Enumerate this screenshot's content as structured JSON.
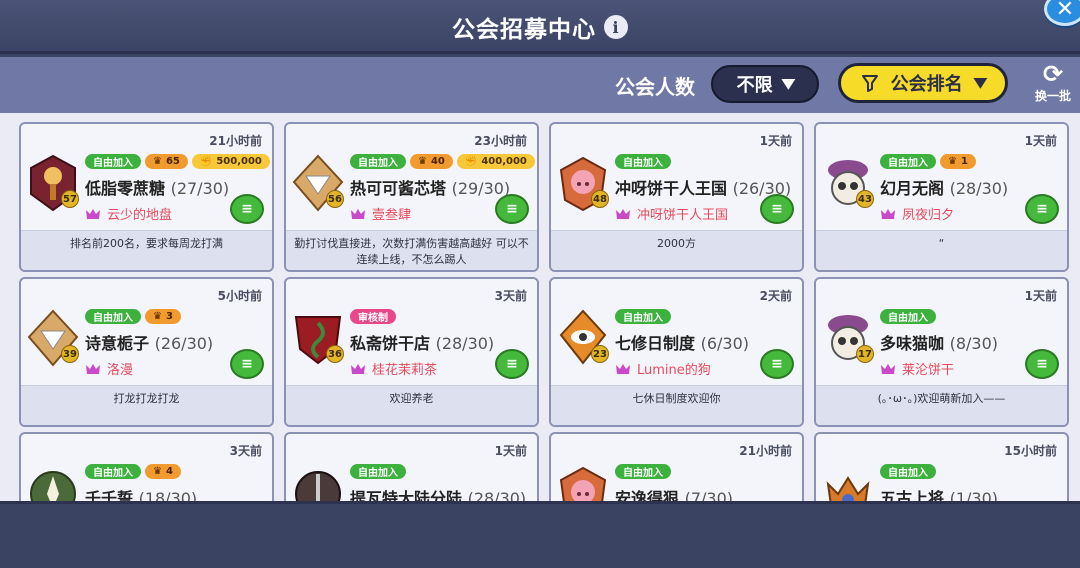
{
  "header": {
    "title": "公会招募中心",
    "info_icon": "info-icon",
    "close_icon": "close-icon"
  },
  "toolbar": {
    "member_label": "公会人数",
    "member_value": "不限",
    "sort_value": "公会排名",
    "refresh_label": "换一批"
  },
  "cards": [
    {
      "time": "21小时前",
      "badges": [
        {
          "type": "green",
          "text": "自由加入"
        },
        {
          "type": "orange",
          "text": "65"
        },
        {
          "type": "gold",
          "text": "500,000"
        }
      ],
      "level": "57",
      "name": "低脂零蔗糖",
      "count": "(27/30)",
      "leader": "云少的地盘",
      "desc": "排名前200名，要求每周龙打满",
      "emblem": "wine"
    },
    {
      "time": "23小时前",
      "badges": [
        {
          "type": "green",
          "text": "自由加入"
        },
        {
          "type": "orange",
          "text": "40"
        },
        {
          "type": "gold",
          "text": "400,000"
        }
      ],
      "level": "56",
      "name": "热可可酱芯塔",
      "count": "(29/30)",
      "leader": "壹叁肆",
      "desc": "勤打讨伐直接进，次数打满伤害越高越好 可以不连续上线，不怎么踢人",
      "emblem": "diamond"
    },
    {
      "time": "1天前",
      "badges": [
        {
          "type": "green",
          "text": "自由加入"
        }
      ],
      "level": "48",
      "name": "冲呀饼干人王国",
      "count": "(26/30)",
      "leader": "冲呀饼干人王国",
      "desc": "2000方",
      "emblem": "pig"
    },
    {
      "time": "1天前",
      "badges": [
        {
          "type": "green",
          "text": "自由加入"
        },
        {
          "type": "orange",
          "text": "1"
        }
      ],
      "level": "43",
      "name": "幻月无阁",
      "count": "(28/30)",
      "leader": "夙夜归夕",
      "desc": "“",
      "emblem": "skull"
    },
    {
      "time": "5小时前",
      "badges": [
        {
          "type": "green",
          "text": "自由加入"
        },
        {
          "type": "orange",
          "text": "3"
        }
      ],
      "level": "39",
      "name": "诗意栀子",
      "count": "(26/30)",
      "leader": "洛漫",
      "desc": "打龙打龙打龙",
      "emblem": "diamond"
    },
    {
      "time": "3天前",
      "badges": [
        {
          "type": "pink",
          "text": "审核制"
        }
      ],
      "level": "36",
      "name": "私斋饼干店",
      "count": "(28/30)",
      "leader": "桂花茉莉茶",
      "desc": "欢迎养老",
      "emblem": "snake"
    },
    {
      "time": "2天前",
      "badges": [
        {
          "type": "green",
          "text": "自由加入"
        }
      ],
      "level": "23",
      "name": "七修日制度",
      "count": "(6/30)",
      "leader": "Lumine的狗",
      "desc": "七休日制度欢迎你",
      "emblem": "eye"
    },
    {
      "time": "1天前",
      "badges": [
        {
          "type": "green",
          "text": "自由加入"
        }
      ],
      "level": "17",
      "name": "多味猫咖",
      "count": "(8/30)",
      "leader": "莱沦饼干",
      "desc": "(｡･ω･｡)欢迎萌新加入——",
      "emblem": "skull"
    },
    {
      "time": "3天前",
      "badges": [
        {
          "type": "green",
          "text": "自由加入"
        },
        {
          "type": "orange",
          "text": "4"
        }
      ],
      "level": "",
      "name": "千千誓",
      "count": "(18/30)",
      "leader": "",
      "desc": "",
      "emblem": "flower"
    },
    {
      "time": "1天前",
      "badges": [
        {
          "type": "green",
          "text": "自由加入"
        }
      ],
      "level": "",
      "name": "提瓦特大陆分陆",
      "count": "(28/30)",
      "leader": "",
      "desc": "",
      "emblem": "sword"
    },
    {
      "time": "21小时前",
      "badges": [
        {
          "type": "green",
          "text": "自由加入"
        }
      ],
      "level": "",
      "name": "安逸得狠",
      "count": "(7/30)",
      "leader": "",
      "desc": "",
      "emblem": "pig"
    },
    {
      "time": "15小时前",
      "badges": [
        {
          "type": "green",
          "text": "自由加入"
        }
      ],
      "level": "",
      "name": "五古上将",
      "count": "(1/30)",
      "leader": "",
      "desc": "",
      "emblem": "crown"
    }
  ],
  "colors": {
    "accent_yellow": "#f6dc29",
    "join_green": "#3cb13d",
    "review_pink": "#e8478a",
    "leader_red": "#e84a5b"
  }
}
